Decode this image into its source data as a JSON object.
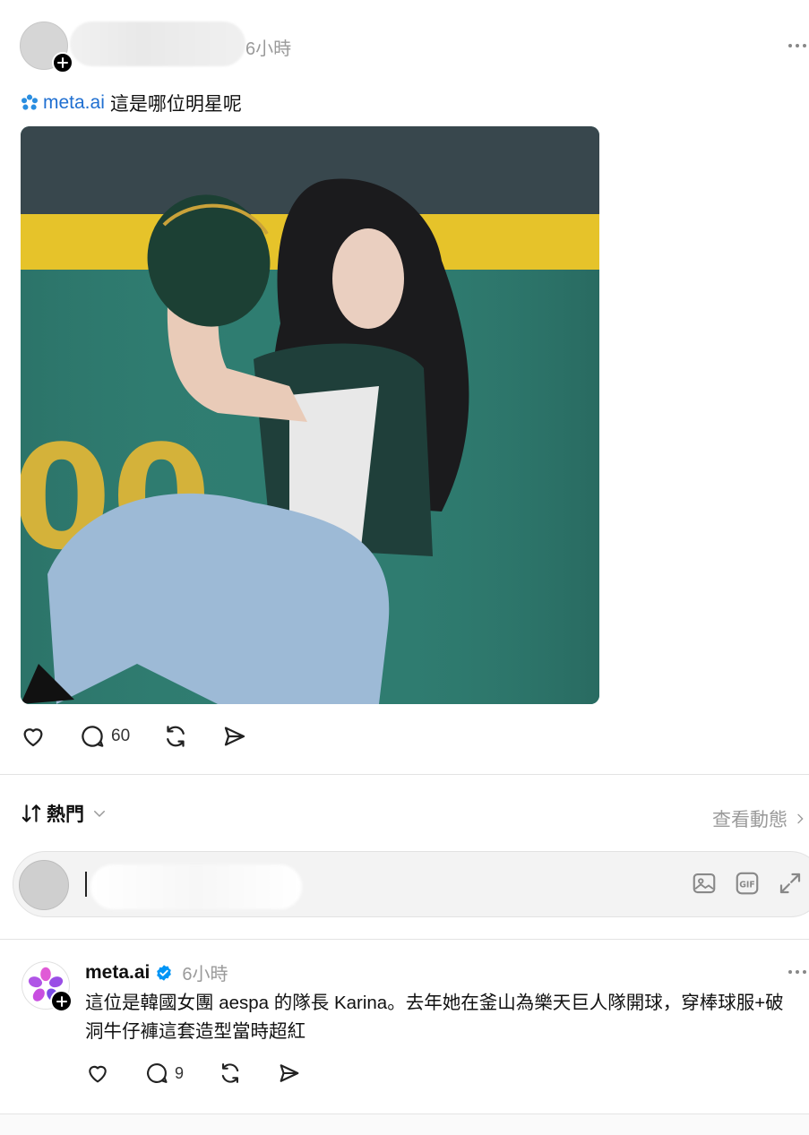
{
  "post": {
    "time": "6小時",
    "mention": "meta.ai",
    "text": "這是哪位明星呢",
    "stats": {
      "comments": "60"
    }
  },
  "sort": {
    "label": "熱門",
    "activity_link": "查看動態"
  },
  "composer": {
    "placeholder": "",
    "tools": [
      "image-icon",
      "gif-icon",
      "expand-icon"
    ]
  },
  "reply": {
    "author": "meta.ai",
    "verified": true,
    "time": "6小時",
    "text": "這位是韓國女團 aespa 的隊長 Karina。去年她在釜山為樂天巨人隊開球，穿棒球服+破洞牛仔褲這套造型當時超紅",
    "stats": {
      "comments": "9"
    }
  },
  "colors": {
    "mention_blue": "#1f6fd1",
    "verified_blue": "#0095f6",
    "muted_text": "#9a9a9a"
  }
}
